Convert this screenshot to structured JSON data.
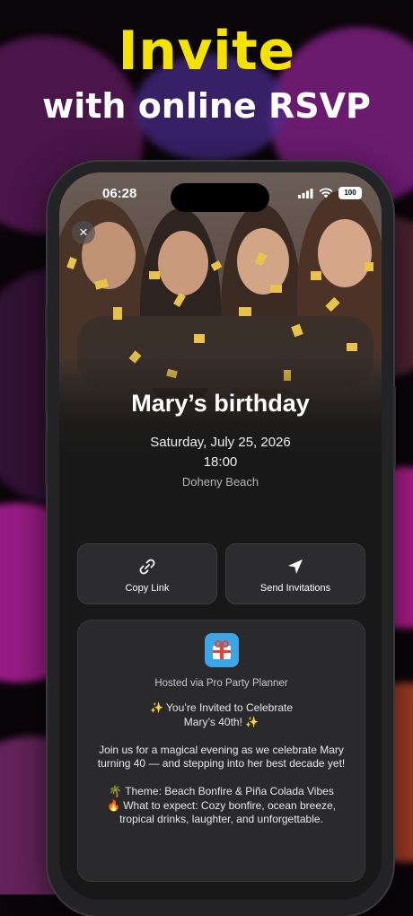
{
  "promo": {
    "headline": "Invite",
    "subheadline": "with online RSVP"
  },
  "status_bar": {
    "time": "06:28",
    "battery": "100"
  },
  "event": {
    "title": "Mary’s birthday",
    "date": "Saturday, July 25, 2026",
    "time": "18:00",
    "location": "Doheny Beach"
  },
  "actions": {
    "copy_link": "Copy Link",
    "send_invitations": "Send Invitations"
  },
  "card": {
    "hosted_by": "Hosted via Pro Party Planner",
    "description": "✨ You’re Invited to Celebrate\nMary’s 40th! ✨\n\nJoin us for a magical evening as we celebrate Mary turning 40 — and stepping into her best decade yet!\n\n🌴 Theme: Beach Bonfire & Piña Colada Vibes\n🔥 What to expect: Cozy bonfire, ocean breeze, tropical drinks, laughter, and unforgettable."
  },
  "icons": {
    "close": "close-icon",
    "link": "link-icon",
    "send": "paper-plane-icon",
    "logo": "gift-icon"
  },
  "colors": {
    "headline": "#f4e200",
    "accent": "#3aa6e8"
  }
}
